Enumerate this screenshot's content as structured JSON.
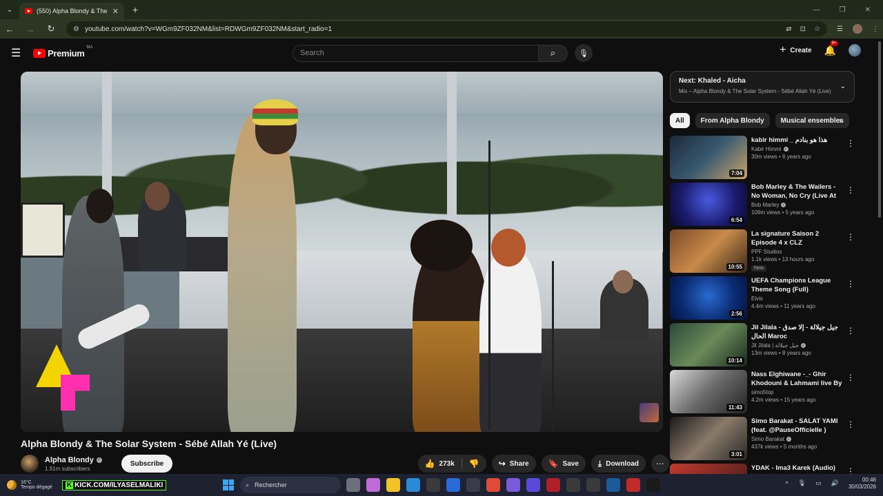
{
  "browser": {
    "tab_title": "(550) Alpha Blondy & The S",
    "tab_close": "✕",
    "new_tab": "+",
    "url": "youtube.com/watch?v=WGm9ZF032NM&list=RDWGm9ZF032NM&start_radio=1"
  },
  "header": {
    "logo_text": "Premium",
    "logo_region": "MA",
    "search_placeholder": "Search",
    "create_label": "Create",
    "notif_badge": "9+"
  },
  "video": {
    "title": "Alpha Blondy & The Solar System - Sébé Allah Yé (Live)",
    "channel": "Alpha Blondy",
    "subscribers": "1.91m subscribers",
    "subscribe_label": "Subscribe",
    "likes": "273k",
    "share_label": "Share",
    "save_label": "Save",
    "download_label": "Download"
  },
  "up_next": {
    "title": "Next: Khaled - Aicha",
    "subtitle": "Mix – Alpha Blondy & The Solar System - Sébé Allah Yé (Live)"
  },
  "chips": [
    "All",
    "From Alpha Blondy",
    "Musical ensembles"
  ],
  "recommendations": [
    {
      "title": "kabir himmi _ هذا هو بنادم",
      "channel": "Kabir Himmi",
      "verified": true,
      "meta": "30m views • 6 years ago",
      "duration": "7:04",
      "thumb": "linear-gradient(135deg,#1b2a3a,#3a5a70 50%,#c9a46a)"
    },
    {
      "title": "Bob Marley & The Wailers - No Woman, No Cry (Live At The ...",
      "channel": "Bob Marley",
      "verified": true,
      "meta": "109m views • 5 years ago",
      "duration": "6:54",
      "thumb": "radial-gradient(circle at 50% 40%,#4a5adf,#1a1a6a 60%,#0a0a2a)"
    },
    {
      "title": "La signature Saison 2 Episode 4 x CLZ",
      "channel": "PPF Studios",
      "verified": false,
      "meta": "1.1k views • 13 hours ago",
      "badge": "New",
      "duration": "10:55",
      "thumb": "linear-gradient(135deg,#7a4a2a,#c98a4a 50%,#3a2a1a)"
    },
    {
      "title": "UEFA Champions League Theme Song (Full)",
      "channel": "Elvis",
      "verified": false,
      "meta": "4.4m views • 11 years ago",
      "duration": "2:56",
      "thumb": "radial-gradient(circle at 50% 45%,#2a6ad0,#0a2a70 60%,#051540)"
    },
    {
      "title": "Jil Jilala - جيل جيلالة - إلا صدق الحال Maroc",
      "channel": "Jil Jilala | جيل جيلالة",
      "verified": true,
      "meta": "13m views • 8 years ago",
      "duration": "10:14",
      "thumb": "linear-gradient(135deg,#2a4a3a,#6a8a5a 50%,#1a2a20)"
    },
    {
      "title": "Nass Elghiwane -_- Ghir Khodouni & Lahmami live  By ...",
      "channel": "simo5top",
      "verified": false,
      "meta": "4.2m views • 15 years ago",
      "duration": "11:43",
      "thumb": "linear-gradient(135deg,#d8d8d8,#6a6a6a 50%,#222)"
    },
    {
      "title": "Simo Barakat - SALAT YAMI (feat. @PauseOfficielle )",
      "channel": "Simo Barakat",
      "verified": true,
      "meta": "437k views • 5 months ago",
      "duration": "3:01",
      "thumb": "linear-gradient(135deg,#1a1a1a,#8a7a6a 50%,#2a2a2a)"
    },
    {
      "title": "YDAK - Ima3 Karek (Audio)",
      "channel": "",
      "verified": false,
      "meta": "",
      "duration": "",
      "thumb": "linear-gradient(135deg,#c23a2c,#3a1a1a)"
    }
  ],
  "taskbar": {
    "temp": "16°C",
    "weather": "Temps dégagé",
    "kick_text": "KICK.COM/ILYASELMALIKI",
    "search_label": "Rechercher",
    "time": "00:46",
    "date": "30/03/2026",
    "app_colors": [
      "#6a7080",
      "#c06ad8",
      "#f2c22a",
      "#2a8ad8",
      "#3a3a3a",
      "#2a6ad8",
      "#3a3a4a",
      "#e04a3a",
      "#7a5ad8",
      "#5a4ad8",
      "#b0202a",
      "#3a3a3a",
      "#3a3a3a",
      "#1a5a9a",
      "#c02a2a",
      "#1a1a1a"
    ]
  }
}
